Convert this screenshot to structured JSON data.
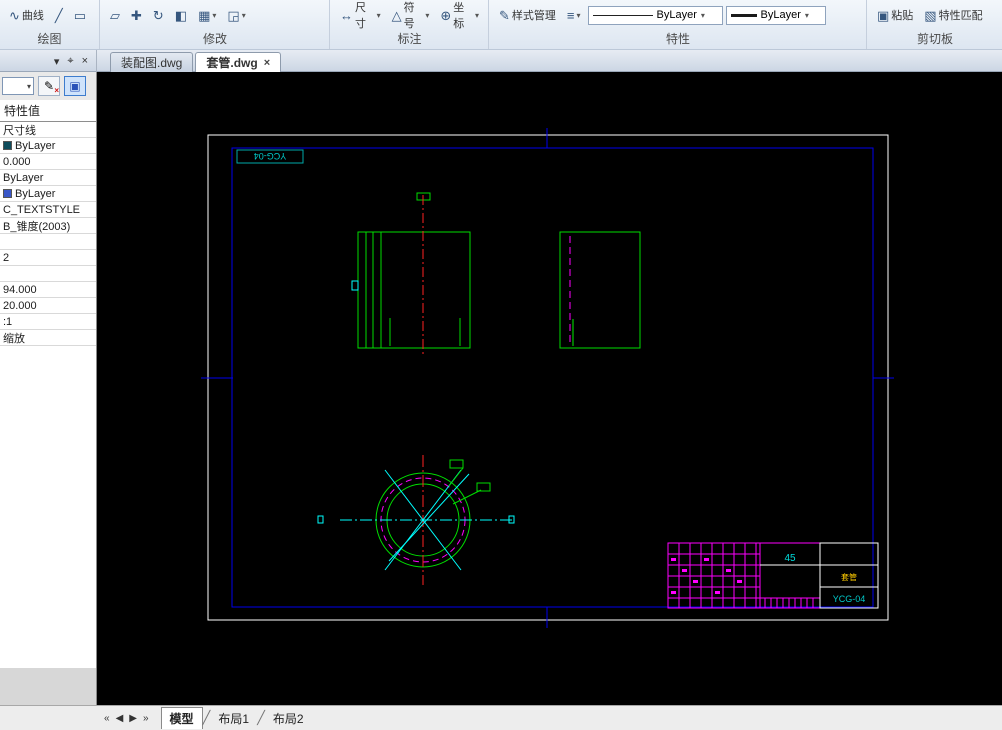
{
  "ribbon": {
    "groups": [
      {
        "label": "绘图"
      },
      {
        "label": "修改"
      },
      {
        "label": "标注"
      },
      {
        "label": "特性"
      },
      {
        "label": "剪切板"
      }
    ],
    "draw_group": {
      "curve": "曲线"
    },
    "annotate": {
      "dim": "尺寸",
      "symbol": "符号",
      "coord": "坐标"
    },
    "props": {
      "style_manager": "样式管理",
      "linetype_value": "ByLayer",
      "color_value": "ByLayer"
    },
    "clipboard": {
      "paste": "粘贴",
      "match": "特性匹配"
    },
    "icons": {
      "curve": "∿",
      "line": "╱",
      "rect": "▭",
      "erase": "▱",
      "move": "✚",
      "rotate": "↻",
      "mirror": "◧",
      "array": "▦",
      "scale": "◲",
      "dim": "↔",
      "symbol": "△",
      "coord": "⊕",
      "style": "✎",
      "menu": "≡",
      "paste": "▣",
      "match": "▧",
      "caret": "▾"
    }
  },
  "panel_toolbar": {
    "dropdown": "▾",
    "pin": "⌖",
    "close": "×"
  },
  "file_tabs": [
    {
      "label": "装配图.dwg"
    },
    {
      "label": "套管.dwg",
      "close": "×"
    }
  ],
  "edit_buttons": {
    "pencil": "✎",
    "pencil_x": "×",
    "select": "▣"
  },
  "panel": {
    "header": "特性值",
    "rows": [
      {
        "value": "尺寸线"
      },
      {
        "value": "ByLayer",
        "swatch": "#0e4c5c"
      },
      {
        "value": "0.000"
      },
      {
        "value": "ByLayer"
      },
      {
        "value": "ByLayer",
        "swatch": "#3a57c8"
      },
      {
        "value": "C_TEXTSTYLE"
      },
      {
        "value": "B_锥度(2003)"
      },
      {
        "value": ""
      },
      {
        "value": "2"
      },
      {
        "value": ""
      },
      {
        "value": "94.000"
      },
      {
        "value": "20.000"
      },
      {
        "value": ":1"
      },
      {
        "value": "缩放"
      }
    ]
  },
  "drawing": {
    "frame_label": "YCG-04",
    "title_block": {
      "material": "45",
      "part_name": "套管",
      "drawing_no": "YCG-04"
    },
    "colors": {
      "frame_blue": "#0000ee",
      "entity_green": "#00dd00",
      "center_red": "#ff2222",
      "aux_cyan": "#00ffff",
      "hidden_magenta": "#ff00ff",
      "border_white": "#ffffff"
    }
  },
  "statusbar": {
    "nav_first": "«",
    "nav_prev": "◀",
    "nav_next": "▶",
    "nav_last": "»",
    "tabs": [
      {
        "label": "模型"
      },
      {
        "label": "布局1"
      },
      {
        "label": "布局2"
      }
    ]
  }
}
